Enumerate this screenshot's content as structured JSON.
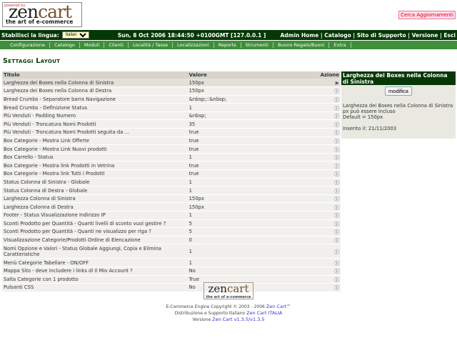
{
  "logo": {
    "powered": "powered by",
    "zen": "zen",
    "cart": "cart",
    "tagline": "the art of e-commerce"
  },
  "update_button": "Cerca Aggiornamenti",
  "topbar": {
    "lang_label": "Stabilisci la lingua:",
    "lang_value": "Italiano",
    "datetime": "Sun, 8 Oct 2006 18:44:50 +0100GMT [127.0.0.1 ]",
    "links": [
      "Admin Home",
      "Catalogo",
      "Sito di Supporto",
      "Versione",
      "Esci"
    ]
  },
  "menu": [
    "Configurazione",
    "Catalogo",
    "Moduli",
    "Clienti",
    "Località / Tasse",
    "Localizzazioni",
    "Reports",
    "Strumenti",
    "Buono Regalo/Buoni",
    "Extra"
  ],
  "page_title": "Settaggi Layout",
  "table": {
    "headers": [
      "Titolo",
      "Valore",
      "Azione"
    ],
    "rows": [
      [
        "Larghezza dei Boxes nella Colonna di Sinistra",
        "150px"
      ],
      [
        "Larghezza dei Boxes nella Colonna di Destra",
        "150px"
      ],
      [
        "Bread Crumbs - Separatore barra Navigazione",
        "&nbsp;::&nbsp;"
      ],
      [
        "Bread Crumbs - Definizione Status",
        "1"
      ],
      [
        "Più Venduti - Padding Numero",
        "&nbsp;"
      ],
      [
        "Più Venduti - Troncatura Nomi Prodotti",
        "35"
      ],
      [
        "Più Venduti - Troncatura Nomi Prodotti seguita da ...",
        "true"
      ],
      [
        "Box Categorie - Mostra Link Offerte",
        "true"
      ],
      [
        "Box Categorie - Mostra Link Nuovi prodotti",
        "true"
      ],
      [
        "Box Carrello - Status",
        "1"
      ],
      [
        "Box Categorie - Mostra link Prodotti in Vetrina",
        "true"
      ],
      [
        "Box Categorie - Mostra link Tutti i Prodotti",
        "true"
      ],
      [
        "Status Colonna di Sinistra - Globale",
        "1"
      ],
      [
        "Status Colonna di Destra - Globale",
        "1"
      ],
      [
        "Larghezza Colonna di Sinistra",
        "150px"
      ],
      [
        "Larghezza Colonna di Destra",
        "150px"
      ],
      [
        "Footer - Status Visualizzazione Indirizzo IP",
        "1"
      ],
      [
        "Sconti Prodotto per Quantità - Quanti livelli di sconto vuoi gestire ?",
        "5"
      ],
      [
        "Sconti Prodotto per Quantità - Quanti ne visualizzo per riga ?",
        "5"
      ],
      [
        "Visualizzazione Categorie/Prodotti Ordine di Elencazione",
        "0"
      ],
      [
        "Nomi Opzione e Valori - Status Globale Aggiungi, Copia e Elimina Caratteristiche",
        "1"
      ],
      [
        "Menù Categorie Tabellare - ON/OFF",
        "1"
      ],
      [
        "Mappa Sito - deve includere i links di Il Mio Account ?",
        "No"
      ],
      [
        "Salta Categorie con 1 prodotto",
        "True"
      ],
      [
        "Pulsanti CSS",
        "No"
      ]
    ]
  },
  "panel": {
    "title": "Larghezza dei Boxes nella Colonna di Sinistra",
    "button": "modifica",
    "desc1": "Larghezza dei Boxes nella Colonna di Sinistra",
    "desc2": "px può essere incluso",
    "desc3": "Default = 150px",
    "inserted": "Inserito il: 21/11/2003"
  },
  "footer": {
    "line1": "E-Commerce Engine Copyright © 2003 - 2006 ",
    "link1": "Zen Cart™",
    "line2": "Distribuzione e Supporto Italiano ",
    "link2": "Zen Cart ITALIA",
    "line3": "Versione ",
    "link3": "Zen Cart v1.3.5/v1.3.5"
  }
}
